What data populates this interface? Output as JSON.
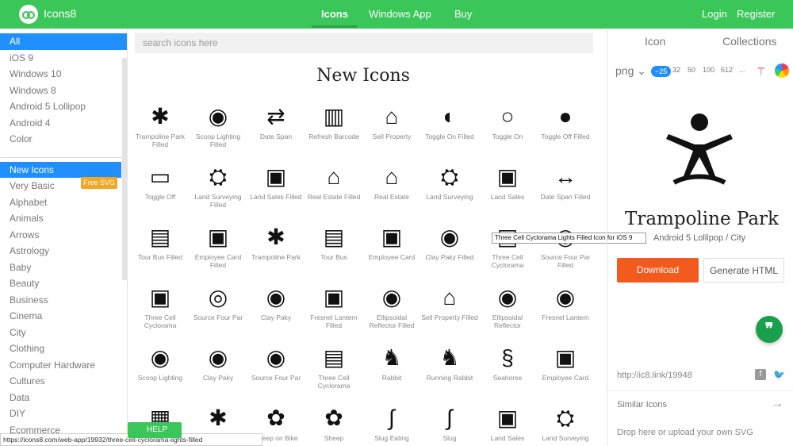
{
  "header": {
    "brand": "Icons8",
    "nav": [
      "Icons",
      "Windows App",
      "Buy"
    ],
    "login": "Login",
    "register": "Register"
  },
  "sidebar": {
    "platforms": [
      "All",
      "iOS 9",
      "Windows 10",
      "Windows 8",
      "Android 5 Lollipop",
      "Android 4",
      "Color"
    ],
    "categories": [
      "New Icons",
      "Very Basic",
      "Alphabet",
      "Animals",
      "Arrows",
      "Astrology",
      "Baby",
      "Beauty",
      "Business",
      "Cinema",
      "City",
      "Clothing",
      "Computer Hardware",
      "Cultures",
      "Data",
      "DIY",
      "Ecommerce"
    ],
    "free_badge": "Free SVG"
  },
  "search": {
    "placeholder": "search icons here"
  },
  "main": {
    "title": "New Icons"
  },
  "icons": [
    [
      "Trampoline Park Filled",
      "Scoop Lighting Filled",
      "Date Span",
      "Refresh Barcode",
      "Sell Property",
      "Toggle On Filled",
      "Toggle On",
      "Toggle Off Filled"
    ],
    [
      "Toggle Off",
      "Land Surveying Filled",
      "Land Sales Filled",
      "Real Estate Filled",
      "Real Estate",
      "Land Surveying",
      "Land Sales",
      "Date Span Filled"
    ],
    [
      "Tour Bus Filled",
      "Employee Card Filled",
      "Trampoline Park",
      "Tour Bus",
      "Employee Card",
      "Clay Paky Filled",
      "Three Cell Cyclorama",
      "Source Four Par Filled"
    ],
    [
      "Three Cell Cyclorama",
      "Source Four Par",
      "Clay Paky",
      "Fresnel Lantern Filled",
      "Ellipsoidal Reflector Filled",
      "Sell Property Filled",
      "Ellipsoidal Reflector",
      "Fresnel Lantern"
    ],
    [
      "Scoop Lighting",
      "Clay Paky",
      "Source Four Par",
      "Three Cell Cyclorama",
      "Rabbit",
      "Running Rabbit",
      "Seahorse",
      "Employee Card"
    ],
    [
      "",
      "",
      "Sheep on Bike",
      "Sheep",
      "Slug Eating",
      "Slug",
      "Land Sales",
      "Land Surveying"
    ]
  ],
  "tooltip": "Three Cell Cyclorama Lights Filled Icon for iOS 9",
  "panel": {
    "tabs": [
      "Icon",
      "Collections"
    ],
    "format": "png",
    "sizes": [
      "~25",
      "32",
      "50",
      "100",
      "512",
      "..."
    ],
    "name": "Trampoline Park",
    "platform": "Android 5 Lollipop / City",
    "download": "Download",
    "generate": "Generate HTML",
    "short_link": "http://ic8.link/19948",
    "similar": "Similar Icons",
    "drop_text": "Drop here or upload your own SVG",
    "drop_link": "upload"
  },
  "status_url": "https://icons8.com/web-app/19932/three-cell-cyclorama-lights-filled",
  "help": "HELP"
}
